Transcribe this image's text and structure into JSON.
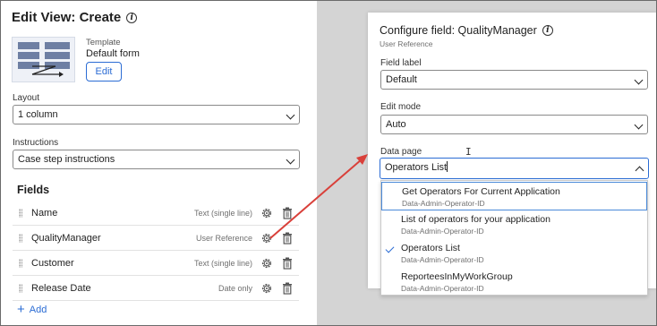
{
  "left_panel": {
    "title": "Edit View: Create",
    "template": {
      "label": "Template",
      "name": "Default form",
      "edit_label": "Edit"
    },
    "layout": {
      "label": "Layout",
      "value": "1 column"
    },
    "instructions": {
      "label": "Instructions",
      "value": "Case step instructions"
    },
    "fields_heading": "Fields",
    "fields": [
      {
        "name": "Name",
        "type": "Text (single line)"
      },
      {
        "name": "QualityManager",
        "type": "User Reference"
      },
      {
        "name": "Customer",
        "type": "Text (single line)"
      },
      {
        "name": "Release Date",
        "type": "Date only"
      }
    ],
    "add_label": "Add"
  },
  "configure_panel": {
    "title": "Configure field: QualityManager",
    "subtitle": "User Reference",
    "field_label": {
      "label": "Field label",
      "value": "Default"
    },
    "edit_mode": {
      "label": "Edit mode",
      "value": "Auto"
    },
    "data_page": {
      "label": "Data page",
      "value": "Operators List"
    },
    "options": [
      {
        "name": "Get Operators For Current Application",
        "class": "Data-Admin-Operator-ID",
        "highlighted": true,
        "selected": false
      },
      {
        "name": "List of operators for your application",
        "class": "Data-Admin-Operator-ID",
        "highlighted": false,
        "selected": false
      },
      {
        "name": "Operators List",
        "class": "Data-Admin-Operator-ID",
        "highlighted": false,
        "selected": true
      },
      {
        "name": "ReporteesInMyWorkGroup",
        "class": "Data-Admin-Operator-ID",
        "highlighted": false,
        "selected": false
      }
    ]
  },
  "colors": {
    "accent": "#2b6cd4",
    "annotation_arrow": "#d9403a",
    "backdrop": "#d4d4d4"
  }
}
